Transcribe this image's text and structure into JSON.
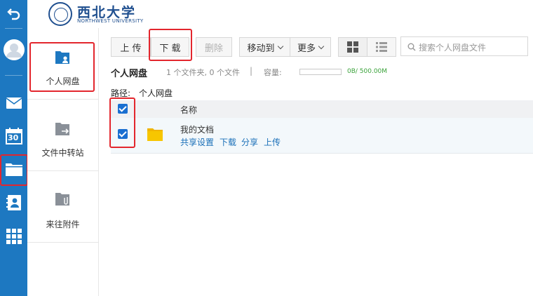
{
  "header": {
    "logo_cn": "西北大学",
    "logo_en": "NORTHWEST UNIVERSITY"
  },
  "rail": {
    "items": [
      "back-icon",
      "user-avatar",
      "mail-icon",
      "calendar-icon",
      "folder-icon",
      "contacts-icon",
      "apps-grid-icon"
    ],
    "calendar_day": "30"
  },
  "sidebar": {
    "items": [
      {
        "label": "个人网盘"
      },
      {
        "label": "文件中转站"
      },
      {
        "label": "来往附件"
      }
    ]
  },
  "toolbar": {
    "upload_label": "上 传",
    "download_label": "下 载",
    "delete_label": "删除",
    "move_label": "移动到",
    "more_label": "更多"
  },
  "search": {
    "placeholder": "搜索个人网盘文件"
  },
  "summary": {
    "title": "个人网盘",
    "counts": "1 个文件夹, 0 个文件",
    "divider": "|",
    "capacity_label": "容量:",
    "capacity_text": "0B/ 500.00M",
    "capacity_used_fraction": 0
  },
  "path": {
    "label": "路径:",
    "value": "个人网盘"
  },
  "table": {
    "header_name": "名称"
  },
  "files": [
    {
      "name": "我的文档",
      "actions": [
        "共享设置",
        "下载",
        "分享",
        "上传"
      ]
    }
  ],
  "colors": {
    "rail": "#1d78c1",
    "highlight": "#e3262d",
    "link": "#1a6fb8",
    "capacity": "#3aa23a"
  }
}
